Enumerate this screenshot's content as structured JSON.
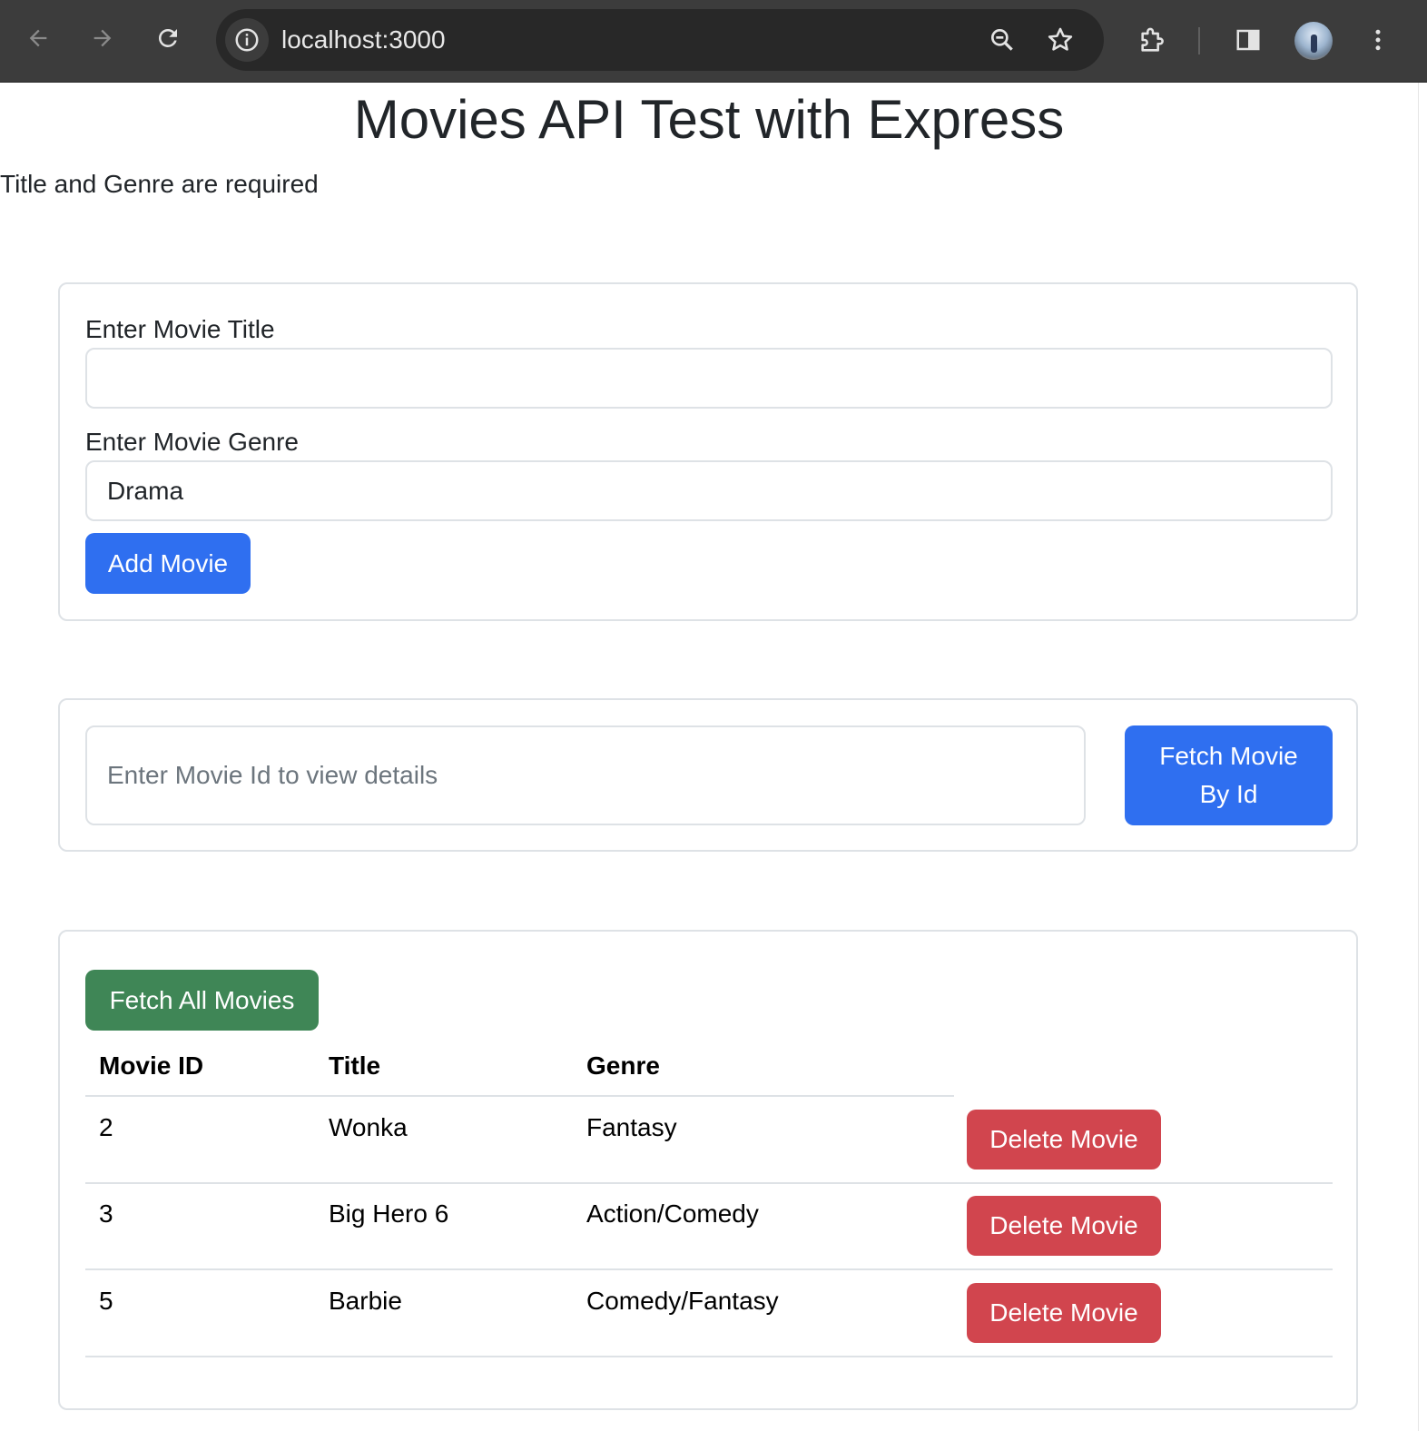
{
  "browser": {
    "url": "localhost:3000"
  },
  "page": {
    "title": "Movies API Test with Express",
    "validation_message": "Title and Genre are required"
  },
  "add_form": {
    "title_label": "Enter Movie Title",
    "title_value": "",
    "genre_label": "Enter Movie Genre",
    "genre_value": "Drama",
    "submit_label": "Add Movie"
  },
  "fetch_by_id": {
    "placeholder": "Enter Movie Id to view details",
    "button_label": "Fetch Movie By Id"
  },
  "movies_list": {
    "fetch_all_label": "Fetch All Movies",
    "columns": [
      "Movie ID",
      "Title",
      "Genre"
    ],
    "delete_label": "Delete Movie",
    "rows": [
      {
        "id": "2",
        "title": "Wonka",
        "genre": "Fantasy"
      },
      {
        "id": "3",
        "title": "Big Hero 6",
        "genre": "Action/Comedy"
      },
      {
        "id": "5",
        "title": "Barbie",
        "genre": "Comedy/Fantasy"
      }
    ]
  },
  "colors": {
    "primary": "#2f6ff0",
    "success": "#3f8656",
    "danger": "#d1454e",
    "chrome": "#3c3c3c"
  },
  "icons": [
    "back-arrow-icon",
    "forward-arrow-icon",
    "reload-icon",
    "site-info-icon",
    "zoom-icon",
    "bookmark-star-icon",
    "extensions-puzzle-icon",
    "side-panel-icon",
    "profile-avatar",
    "more-menu-icon"
  ]
}
